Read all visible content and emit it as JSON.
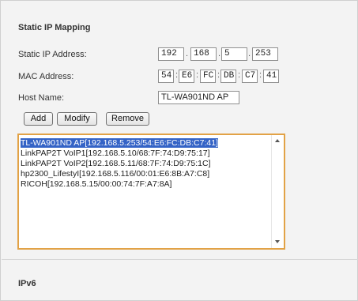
{
  "section": {
    "title": "Static IP Mapping",
    "next_section_title": "IPv6"
  },
  "fields": {
    "static_ip_label": "Static IP Address:",
    "static_ip_octets": [
      "192",
      "168",
      "5",
      "253"
    ],
    "mac_label": "MAC Address:",
    "mac_octets": [
      "54",
      "E6",
      "FC",
      "DB",
      "C7",
      "41"
    ],
    "host_label": "Host Name:",
    "host_value": "TL-WA901ND AP"
  },
  "buttons": {
    "add": "Add",
    "modify": "Modify",
    "remove": "Remove"
  },
  "mapping_list": {
    "entries": [
      "TL-WA901ND AP[192.168.5.253/54:E6:FC:DB:C7:41]",
      "LinkPAP2T VoIP1[192.168.5.10/68:7F:74:D9:75:17]",
      "LinkPAP2T VoIP2[192.168.5.11/68:7F:74:D9:75:1C]",
      "hp2300_LifestyI[192.168.5.116/00:01:E6:8B:A7:C8]",
      "RICOH[192.168.5.15/00:00:74:7F:A7:8A]"
    ],
    "selected_index": 0
  },
  "colors": {
    "selection": "#3463c6",
    "list_focus_border": "#e2a246"
  }
}
